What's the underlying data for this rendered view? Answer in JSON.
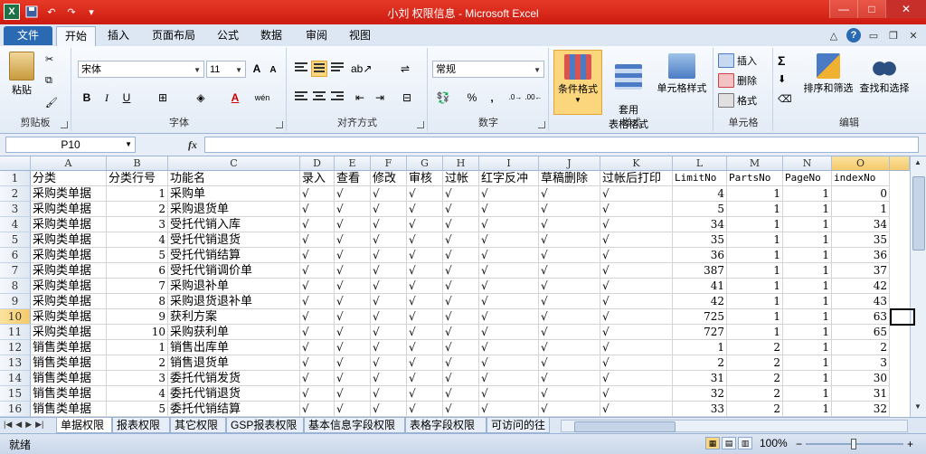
{
  "window": {
    "title": "小刘 权限信息 - Microsoft Excel",
    "quick_access": [
      "excel-logo",
      "save-icon",
      "undo-icon",
      "redo-icon",
      "customize-icon"
    ],
    "win_buttons": [
      "—",
      "□",
      "✕"
    ]
  },
  "ribbon_tabs": [
    "文件",
    "开始",
    "插入",
    "页面布局",
    "公式",
    "数据",
    "审阅",
    "视图"
  ],
  "active_tab": "开始",
  "ribbon": {
    "clipboard": {
      "label": "剪贴板",
      "paste": "粘贴"
    },
    "font": {
      "label": "字体",
      "name": "宋体",
      "size": "11",
      "bold": "B",
      "italic": "I",
      "underline": "U",
      "grow": "A",
      "shrink": "A",
      "color_a": "A",
      "wen": "wén"
    },
    "alignment": {
      "label": "对齐方式"
    },
    "number": {
      "label": "数字",
      "format": "常规",
      "percent": "%",
      "comma": ","
    },
    "styles": {
      "label": "样式",
      "cond": "条件格式",
      "table": "套用\n表格格式",
      "cell": "单元格样式"
    },
    "cells": {
      "label": "单元格",
      "insert": "插入",
      "delete": "删除",
      "format": "格式"
    },
    "editing": {
      "label": "编辑",
      "sum": "Σ",
      "sort": "排序和筛选",
      "find": "查找和选择"
    }
  },
  "formula_bar": {
    "name_box": "P10",
    "fx": "fx",
    "value": ""
  },
  "columns": [
    "A",
    "B",
    "C",
    "D",
    "E",
    "F",
    "G",
    "H",
    "I",
    "J",
    "K",
    "L",
    "M",
    "N",
    "O"
  ],
  "selected_column": "O",
  "selected_row": 10,
  "header_row": [
    "分类",
    "分类行号",
    "功能名",
    "录入",
    "查看",
    "修改",
    "审核",
    "过帐",
    "红字反冲",
    "草稿删除",
    "过帐后打印",
    "LimitNo",
    "PartsNo",
    "PageNo",
    "indexNo"
  ],
  "check_mark": "√",
  "rows": [
    {
      "n": 2,
      "a": "采购类单据",
      "b": "1",
      "c": "采购单",
      "l": "4",
      "m": "1",
      "nn": "1",
      "o": "0"
    },
    {
      "n": 3,
      "a": "采购类单据",
      "b": "2",
      "c": "采购退货单",
      "l": "5",
      "m": "1",
      "nn": "1",
      "o": "1"
    },
    {
      "n": 4,
      "a": "采购类单据",
      "b": "3",
      "c": "受托代销入库",
      "l": "34",
      "m": "1",
      "nn": "1",
      "o": "34"
    },
    {
      "n": 5,
      "a": "采购类单据",
      "b": "4",
      "c": "受托代销退货",
      "l": "35",
      "m": "1",
      "nn": "1",
      "o": "35"
    },
    {
      "n": 6,
      "a": "采购类单据",
      "b": "5",
      "c": "受托代销结算",
      "l": "36",
      "m": "1",
      "nn": "1",
      "o": "36"
    },
    {
      "n": 7,
      "a": "采购类单据",
      "b": "6",
      "c": "受托代销调价单",
      "l": "387",
      "m": "1",
      "nn": "1",
      "o": "37"
    },
    {
      "n": 8,
      "a": "采购类单据",
      "b": "7",
      "c": "采购退补单",
      "l": "41",
      "m": "1",
      "nn": "1",
      "o": "42"
    },
    {
      "n": 9,
      "a": "采购类单据",
      "b": "8",
      "c": "采购退货退补单",
      "l": "42",
      "m": "1",
      "nn": "1",
      "o": "43"
    },
    {
      "n": 10,
      "a": "采购类单据",
      "b": "9",
      "c": "获利方案",
      "l": "725",
      "m": "1",
      "nn": "1",
      "o": "63"
    },
    {
      "n": 11,
      "a": "采购类单据",
      "b": "10",
      "c": "采购获利单",
      "l": "727",
      "m": "1",
      "nn": "1",
      "o": "65"
    },
    {
      "n": 12,
      "a": "销售类单据",
      "b": "1",
      "c": "销售出库单",
      "l": "1",
      "m": "2",
      "nn": "1",
      "o": "2"
    },
    {
      "n": 13,
      "a": "销售类单据",
      "b": "2",
      "c": "销售退货单",
      "l": "2",
      "m": "2",
      "nn": "1",
      "o": "3"
    },
    {
      "n": 14,
      "a": "销售类单据",
      "b": "3",
      "c": "委托代销发货",
      "l": "31",
      "m": "2",
      "nn": "1",
      "o": "30"
    },
    {
      "n": 15,
      "a": "销售类单据",
      "b": "4",
      "c": "委托代销退货",
      "l": "32",
      "m": "2",
      "nn": "1",
      "o": "31"
    },
    {
      "n": 16,
      "a": "销售类单据",
      "b": "5",
      "c": "委托代销结算",
      "l": "33",
      "m": "2",
      "nn": "1",
      "o": "32"
    }
  ],
  "sheet_tabs": [
    "单据权限",
    "报表权限",
    "其它权限",
    "GSP报表权限",
    "基本信息字段权限",
    "表格字段权限",
    "可访问的往"
  ],
  "active_sheet": "单据权限",
  "status": {
    "ready": "就绪",
    "zoom": "100%",
    "minus": "−",
    "plus": "+"
  },
  "colors": {
    "title_red": "#d8271b",
    "file_blue": "#2a6ab3",
    "select_orange": "#f5c96a"
  }
}
